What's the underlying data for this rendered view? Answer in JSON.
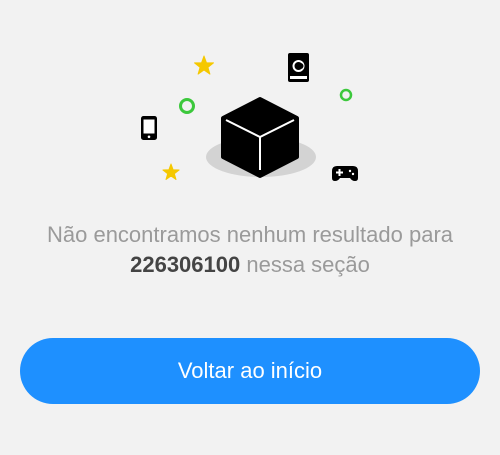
{
  "empty_state": {
    "message_line1": "Não encontramos nenhum resultado para",
    "query": "226306100",
    "message_suffix": "nessa seção",
    "illustration_icons": [
      "box-icon",
      "star-icon",
      "ring-icon",
      "smartphone-icon",
      "book-icon",
      "gamepad-icon"
    ]
  },
  "actions": {
    "back_label": "Voltar ao início"
  },
  "colors": {
    "background": "#f2f2f2",
    "button": "#1e90ff",
    "star": "#f5c800",
    "ring": "#3cc83c",
    "text_muted": "#9a9a9a",
    "text_strong": "#444444"
  }
}
